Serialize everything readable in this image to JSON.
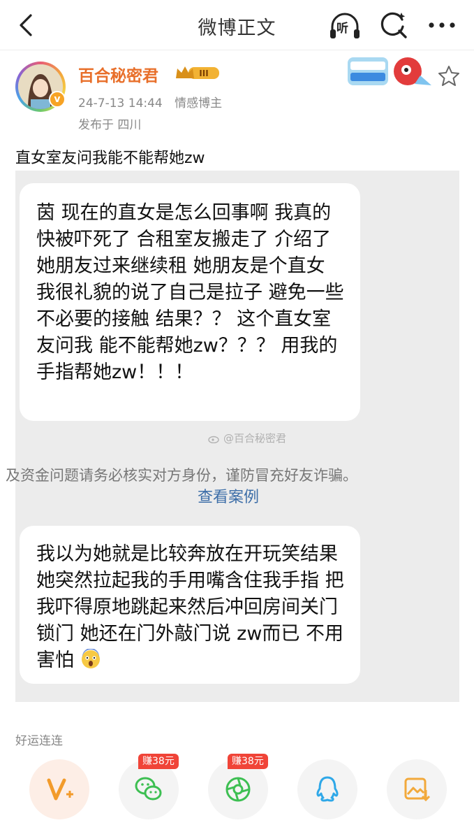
{
  "nav": {
    "title": "微博正文",
    "listen_label": "听"
  },
  "author": {
    "name": "百合秘密君",
    "level": "III",
    "date": "24-7-13 14:44",
    "tag": "情感博主",
    "location": "发布于 四川"
  },
  "post": {
    "text": "直女室友问我能不能帮她zw"
  },
  "screenshot": {
    "bubble1": "茵 现在的直女是怎么回事啊 我真的快被吓死了 合租室友搬走了 介绍了她朋友过来继续租 她朋友是个直女 我很礼貌的说了自己是拉子 避免一些不必要的接触 结果？？ 这个直女室友问我 能不能帮她zw？？？ 用我的手指帮她zw！！！",
    "watermark": "@百合秘密君",
    "warning": "及资金问题请务必核实对方身份，谨防冒充好友诈骗。",
    "view_case": "查看案例",
    "bubble2": "我以为她就是比较奔放在开玩笑结果她突然拉起我的手用嘴含住我手指 把我吓得原地跳起来然后冲回房间关门锁门 她还在门外敲门说 zw而已 不用害怕"
  },
  "bottom": {
    "luck": "好运连连",
    "share": [
      {
        "icon": "v-plus-icon"
      },
      {
        "icon": "wechat-icon",
        "badge": "赚38元"
      },
      {
        "icon": "moments-icon",
        "badge": "赚38元"
      },
      {
        "icon": "qq-icon"
      },
      {
        "icon": "save-image-icon"
      }
    ]
  },
  "colors": {
    "author": "#e86f2a",
    "link": "#3d6ea8",
    "badge": "#f04438",
    "bubble_bg": "#ececec"
  }
}
